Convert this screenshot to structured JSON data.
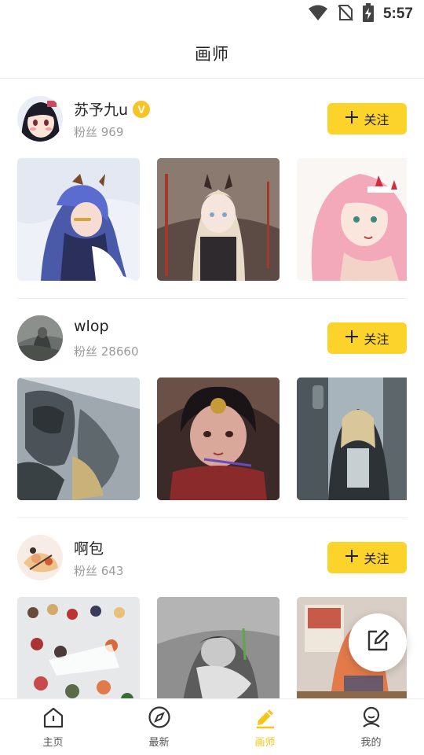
{
  "status_bar": {
    "time": "5:57"
  },
  "page": {
    "title": "画师"
  },
  "follow_label": "关注",
  "artists": [
    {
      "name": "苏予九u",
      "verified_badge": "V",
      "fans": "粉丝 969",
      "avatar_icon": "anime-girl-avatar"
    },
    {
      "name": "wlop",
      "fans": "粉丝 28660",
      "avatar_icon": "dark-painting-avatar"
    },
    {
      "name": "啊包",
      "fans": "粉丝 643",
      "avatar_icon": "chibi-avatar"
    }
  ],
  "tabs": [
    {
      "label": "主页",
      "icon": "home-icon"
    },
    {
      "label": "最新",
      "icon": "compass-icon"
    },
    {
      "label": "画师",
      "icon": "pen-icon",
      "active": true
    },
    {
      "label": "我的",
      "icon": "user-icon"
    }
  ],
  "colors": {
    "accent": "#fcd32a",
    "active_tab": "#f5c518",
    "muted_text": "#9a9a9a"
  }
}
